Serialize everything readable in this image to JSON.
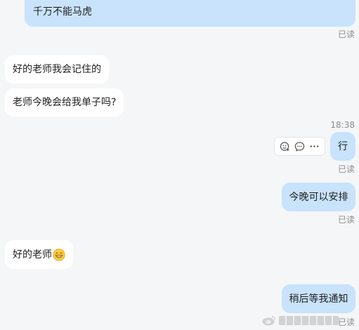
{
  "messages": {
    "m1": {
      "text": "千万不能马虎",
      "status": "已读"
    },
    "m2": {
      "text": "好的老师我会记住的"
    },
    "m3": {
      "text": "老师今晚会给我单子吗?"
    },
    "timestamp": "18:38",
    "m4": {
      "text": "行",
      "status": "已读"
    },
    "m5": {
      "text": "今晚可以安排",
      "status": "已读"
    },
    "m6": {
      "text": "好的老师",
      "emoji": "grinning-face-emoji"
    },
    "m7": {
      "text": "稍后等我通知",
      "status": "已读"
    }
  },
  "action_bar": {
    "icons": [
      "sticker-add-icon",
      "reply-icon",
      "more-icon"
    ]
  },
  "colors": {
    "background": "#f5f6f7",
    "incoming_bubble": "#ffffff",
    "outgoing_bubble": "#c8e3fb",
    "status_text": "#8c8c8c"
  }
}
